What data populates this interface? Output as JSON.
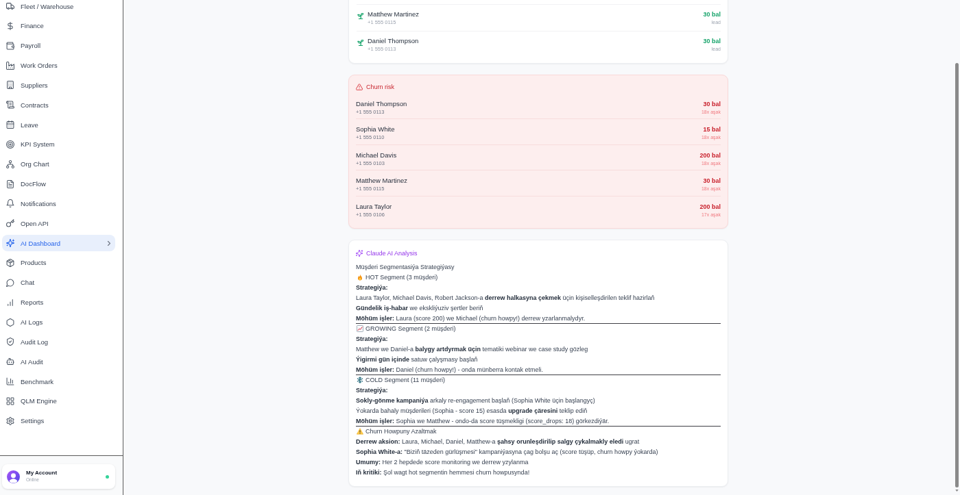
{
  "sidebar": {
    "items": [
      {
        "label": "Fleet / Warehouse",
        "selected": false
      },
      {
        "label": "Finance",
        "selected": false
      },
      {
        "label": "Payroll",
        "selected": false
      },
      {
        "label": "Work Orders",
        "selected": false
      },
      {
        "label": "Suppliers",
        "selected": false
      },
      {
        "label": "Contracts",
        "selected": false
      },
      {
        "label": "Leave",
        "selected": false
      },
      {
        "label": "KPI System",
        "selected": false
      },
      {
        "label": "Org Chart",
        "selected": false
      },
      {
        "label": "DocFlow",
        "selected": false
      },
      {
        "label": "Notifications",
        "selected": false
      },
      {
        "label": "Open API",
        "selected": false
      },
      {
        "label": "AI Dashboard",
        "selected": true
      },
      {
        "label": "Products",
        "selected": false
      },
      {
        "label": "Chat",
        "selected": false
      },
      {
        "label": "Reports",
        "selected": false
      },
      {
        "label": "AI Logs",
        "selected": false
      },
      {
        "label": "Audit Log",
        "selected": false
      },
      {
        "label": "AI Audit",
        "selected": false
      },
      {
        "label": "Benchmark",
        "selected": false
      },
      {
        "label": "QLM Engine",
        "selected": false
      },
      {
        "label": "Settings",
        "selected": false
      }
    ],
    "account": {
      "name": "My Account",
      "status": "Online",
      "online": true
    }
  },
  "lead_list": {
    "rows": [
      {
        "name": "Matthew Martinez",
        "phone": "+1 555 0115",
        "score": "30 bal",
        "tag": "lead"
      },
      {
        "name": "Daniel Thompson",
        "phone": "+1 555 0113",
        "score": "30 bal",
        "tag": "lead"
      }
    ]
  },
  "churn_risk": {
    "title": "Churn risk",
    "rows": [
      {
        "name": "Daniel Thompson",
        "phone": "+1 555 0113",
        "score": "30 bal",
        "note": "18x aşak"
      },
      {
        "name": "Sophia White",
        "phone": "+1 555 0110",
        "score": "15 bal",
        "note": "18x aşak"
      },
      {
        "name": "Michael Davis",
        "phone": "+1 555 0103",
        "score": "200 bal",
        "note": "18x aşak"
      },
      {
        "name": "Matthew Martinez",
        "phone": "+1 555 0115",
        "score": "30 bal",
        "note": "18x aşak"
      },
      {
        "name": "Laura Taylor",
        "phone": "+1 555 0106",
        "score": "200 bal",
        "note": "17x aşak"
      }
    ]
  },
  "ai_analysis": {
    "title": "Claude AI Analysis",
    "lines": [
      {
        "kind": "text",
        "text": "Müşderi Segmentasiýa Strategiýasy"
      },
      {
        "kind": "heading",
        "text": "HOT Segment (3 müşderi)"
      },
      {
        "kind": "label",
        "text": "Strategiýa:"
      },
      {
        "kind": "text",
        "text": "Laura Taylor, Michael Davis, Robert Jackson-a **derrew halkasyna çekmek** üçin kişiselleşdirilen teklif hazirlaň"
      },
      {
        "kind": "text",
        "text": "**Gündelik iş-habar** we ekskliýuziv şertler beriň"
      },
      {
        "kind": "text",
        "text": "**Möhüm işler:** Laura (score 200) we Michael (churn howpy!) derrew yzarlanmalydyr."
      },
      {
        "kind": "rule"
      },
      {
        "kind": "heading",
        "text": "GROWING Segment (2 müşderi)"
      },
      {
        "kind": "label",
        "text": "Strategiýa:"
      },
      {
        "kind": "text",
        "text": "Matthew we Daniel-a **balygy artdyrmak üçin** tematiki webinar we case study gözleg"
      },
      {
        "kind": "text",
        "text": "**Ýigirmi gün içinde** satuw çalyşmasy başlaň"
      },
      {
        "kind": "text",
        "text": "**Möhüm işler:** Daniel (churn howpy!) - onda münberra kontak etmeli."
      },
      {
        "kind": "rule"
      },
      {
        "kind": "heading",
        "text": "COLD Segment (11 müşderi)"
      },
      {
        "kind": "label",
        "text": "Strategiýa:"
      },
      {
        "kind": "text",
        "text": "**Sokly-gönme kampaniýa** arkaly re-engagement başlaň (Sophia White üçin başlangyç)"
      },
      {
        "kind": "text",
        "text": "Ýokarda bahaly müşderileri (Sophia - score 15) esasda **upgrade çäresini** teklip ediň"
      },
      {
        "kind": "text",
        "text": "**Möhüm işler:** Sophia we Matthew - ondo-da score tüşmekligi (score_drops: 18) görkezdiýär."
      },
      {
        "kind": "rule"
      },
      {
        "kind": "heading",
        "text": "Churn Howpuny Azaltmak"
      },
      {
        "kind": "text",
        "text": "**Derrew aksion:** Laura, Michael, Daniel, Matthew-a **şahsy orunleşdirilip salgy çykalmakly eledi** ugrat"
      },
      {
        "kind": "text",
        "text": "**Sophia White-a:** \"Biziň täzeden gürlüşmesi\" kampaniýasyna çag bolşu aç (score tüşüp, churn howpy ýokarda)"
      },
      {
        "kind": "text",
        "text": "**Umumy:** Her 2 hepdede score monitoring we derrew yzylanma"
      },
      {
        "kind": "text",
        "text": "**Iň kritiki:** Şol wagt hot segmentin hemmesi churn howpusynda!"
      }
    ]
  }
}
